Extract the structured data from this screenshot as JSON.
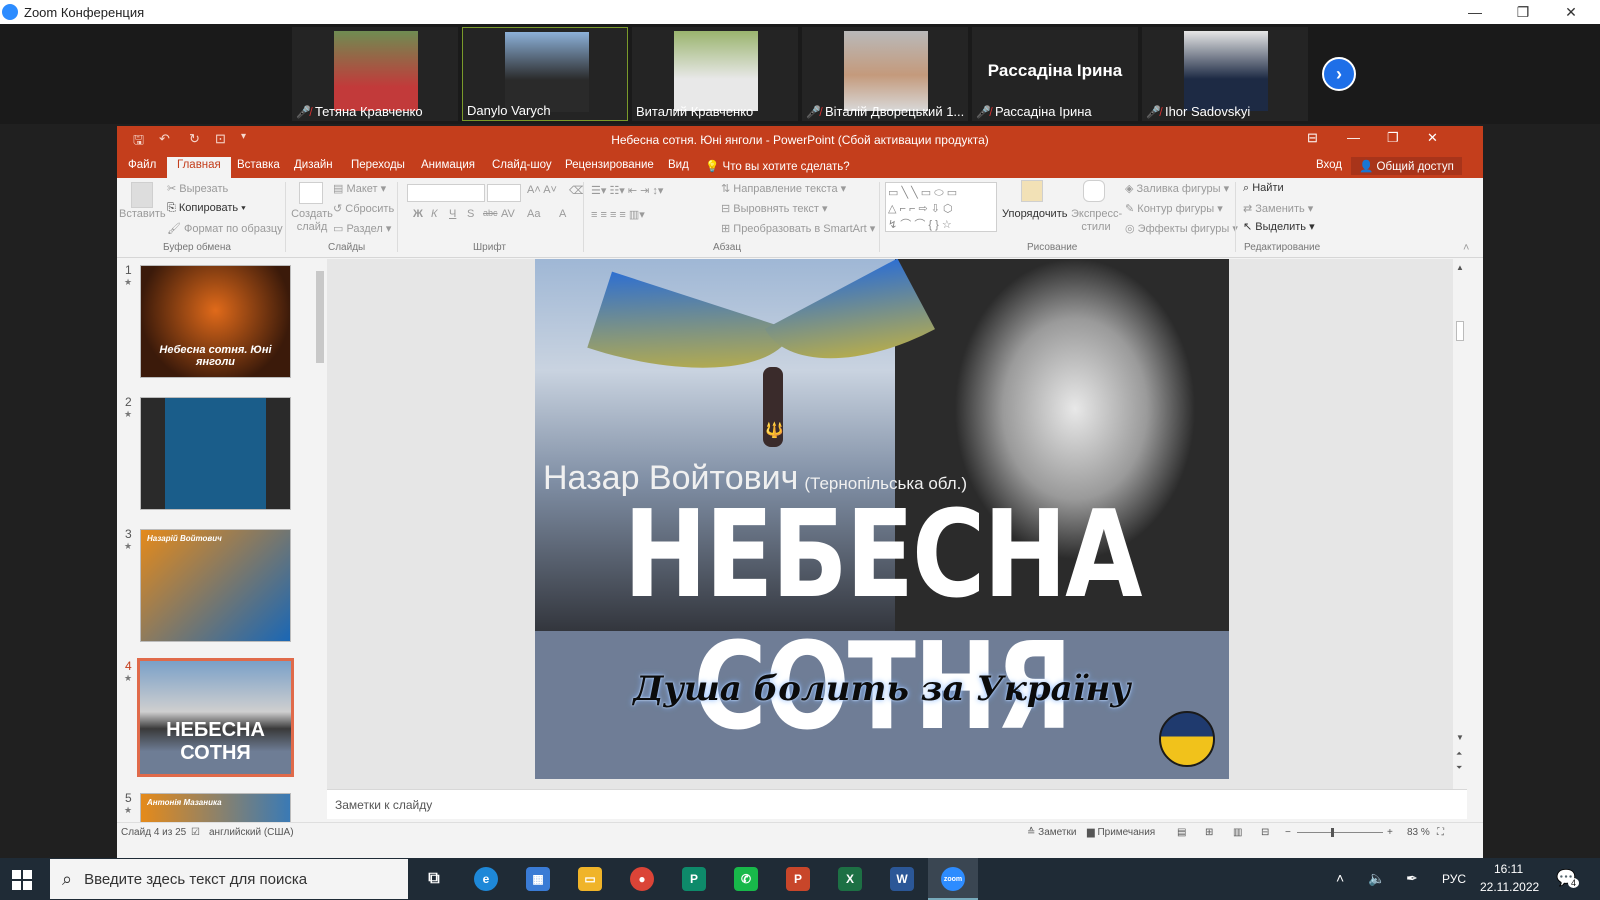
{
  "zoom": {
    "title": "Zoom Конференция",
    "next_icon": "chevron-right-icon"
  },
  "participants": [
    {
      "name": "Тетяна Кравченко",
      "muted": true
    },
    {
      "name": "Danylo Varych",
      "muted": false,
      "active": true
    },
    {
      "name": "Виталий Кравченко",
      "muted": false
    },
    {
      "name": "Віталій Дворецький 1...",
      "muted": true
    },
    {
      "name": "Рассадіна Ірина",
      "muted": true,
      "video_off_label": "Рассадіна Ірина"
    },
    {
      "name": "Ihor Sadovskyi",
      "muted": true
    }
  ],
  "ppt": {
    "title": "Небесна сотня. Юні янголи - PowerPoint (Сбой активации продукта)",
    "tabs": [
      "Файл",
      "Главная",
      "Вставка",
      "Дизайн",
      "Переходы",
      "Анимация",
      "Слайд-шоу",
      "Рецензирование",
      "Вид"
    ],
    "tell_me": "Что вы хотите сделать?",
    "signin": "Вход",
    "share": "Общий доступ",
    "ribbon": {
      "paste": "Вставить",
      "cut": "Вырезать",
      "copy": "Копировать",
      "format_painter": "Формат по образцу",
      "group_clipboard": "Буфер обмена",
      "new_slide": "Создать слайд",
      "layout": "Макет",
      "reset": "Сбросить",
      "section": "Раздел",
      "group_slides": "Слайды",
      "group_font": "Шрифт",
      "text_direction": "Направление текста",
      "align_text": "Выровнять текст",
      "smartart": "Преобразовать в SmartArt",
      "group_paragraph": "Абзац",
      "arrange": "Упорядочить",
      "quick_styles": "Экспресс-стили",
      "shape_fill": "Заливка фигуры",
      "shape_outline": "Контур фигуры",
      "shape_effects": "Эффекты фигуры",
      "group_drawing": "Рисование",
      "find": "Найти",
      "replace": "Заменить",
      "select": "Выделить",
      "group_editing": "Редактирование",
      "font_buttons": [
        "Ж",
        "К",
        "Ч",
        "S",
        "abc",
        "AV",
        "Aa",
        "A"
      ]
    },
    "thumbnails": [
      {
        "num": "1",
        "text": "Небесна сотня. Юні янголи"
      },
      {
        "num": "2",
        "text": ""
      },
      {
        "num": "3",
        "text": "Назарій Войтович"
      },
      {
        "num": "4",
        "text": "НЕБЕСНА СОТНЯ",
        "current": true
      },
      {
        "num": "5",
        "text": "Антонія Мазаника"
      }
    ],
    "slide": {
      "name": "Назар Войтович",
      "region": "(Тернопільська обл.)",
      "headline": "НЕБЕСНА СОТНЯ",
      "subtitle": "Душа болить за Україну"
    },
    "notes_placeholder": "Заметки к слайду",
    "status": {
      "slide_info": "Слайд 4 из 25",
      "language": "английский (США)",
      "notes": "Заметки",
      "comments": "Примечания",
      "zoom": "83 %"
    }
  },
  "taskbar": {
    "search_placeholder": "Введите здесь текст для поиска",
    "lang": "РУС",
    "time": "16:11",
    "date": "22.11.2022",
    "notif_count": "4"
  }
}
